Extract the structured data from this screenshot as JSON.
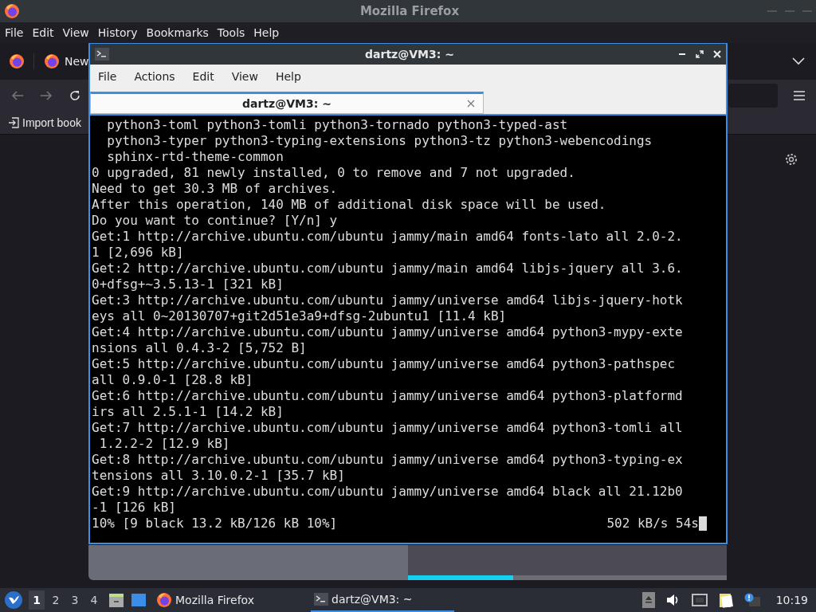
{
  "browser": {
    "title": "Mozilla Firefox",
    "menu": [
      "File",
      "Edit",
      "View",
      "History",
      "Bookmarks",
      "Tools",
      "Help"
    ],
    "tab": {
      "label": "New"
    },
    "bookmark": {
      "label": "Import book"
    }
  },
  "terminal": {
    "title": "dartz@VM3: ~",
    "menu": [
      "File",
      "Actions",
      "Edit",
      "View",
      "Help"
    ],
    "tab": {
      "label": "dartz@VM3: ~",
      "selected": true
    },
    "lines": [
      "  python3-toml python3-tomli python3-tornado python3-typed-ast",
      "  python3-typer python3-typing-extensions python3-tz python3-webencodings",
      "  sphinx-rtd-theme-common",
      "0 upgraded, 81 newly installed, 0 to remove and 7 not upgraded.",
      "Need to get 30.3 MB of archives.",
      "After this operation, 140 MB of additional disk space will be used.",
      "Do you want to continue? [Y/n] y",
      "Get:1 http://archive.ubuntu.com/ubuntu jammy/main amd64 fonts-lato all 2.0-2.",
      "1 [2,696 kB]",
      "Get:2 http://archive.ubuntu.com/ubuntu jammy/main amd64 libjs-jquery all 3.6.",
      "0+dfsg+~3.5.13-1 [321 kB]",
      "Get:3 http://archive.ubuntu.com/ubuntu jammy/universe amd64 libjs-jquery-hotk",
      "eys all 0~20130707+git2d51e3a9+dfsg-2ubuntu1 [11.4 kB]",
      "Get:4 http://archive.ubuntu.com/ubuntu jammy/universe amd64 python3-mypy-exte",
      "nsions all 0.4.3-2 [5,752 B]",
      "Get:5 http://archive.ubuntu.com/ubuntu jammy/universe amd64 python3-pathspec",
      "all 0.9.0-1 [28.8 kB]",
      "Get:6 http://archive.ubuntu.com/ubuntu jammy/universe amd64 python3-platformd",
      "irs all 2.5.1-1 [14.2 kB]",
      "Get:7 http://archive.ubuntu.com/ubuntu jammy/universe amd64 python3-tomli all",
      " 1.2.2-2 [12.9 kB]",
      "Get:8 http://archive.ubuntu.com/ubuntu jammy/universe amd64 python3-typing-ex",
      "tensions all 3.10.0.2-1 [35.7 kB]",
      "Get:9 http://archive.ubuntu.com/ubuntu jammy/universe amd64 black all 21.12b0",
      "-1 [126 kB]"
    ],
    "status_left": "10% [9 black 13.2 kB/126 kB 10%]",
    "status_right": "502 kB/s 54s"
  },
  "progress": {
    "level": 0.33
  },
  "taskbar": {
    "workspaces": [
      {
        "label": "1",
        "selected": true
      },
      {
        "label": "2",
        "selected": false
      },
      {
        "label": "3",
        "selected": false
      },
      {
        "label": "4",
        "selected": false
      }
    ],
    "tasks": [
      {
        "kind": "browser",
        "label": "Mozilla Firefox",
        "selected": false
      },
      {
        "kind": "terminal",
        "label": "dartz@VM3: ~",
        "selected": true
      }
    ],
    "clock": "10:19"
  }
}
